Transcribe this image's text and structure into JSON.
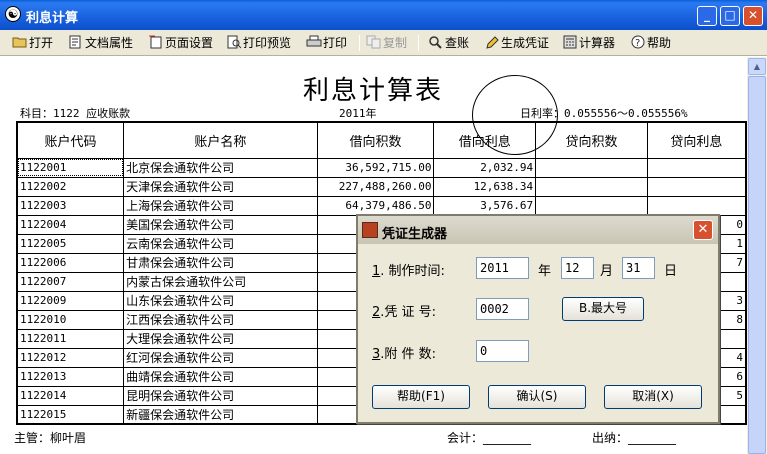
{
  "window": {
    "title": "利息计算",
    "minimize_label": "_",
    "maximize_label": "□",
    "close_label": "✕"
  },
  "toolbar": {
    "open": "打开",
    "doc_props": "文档属性",
    "page_setup": "页面设置",
    "print_preview": "打印预览",
    "print": "打印",
    "copy": "复制",
    "lookup": "查账",
    "gen_voucher": "生成凭证",
    "calculator": "计算器",
    "help": "帮助"
  },
  "report": {
    "title": "利息计算表",
    "subject": "科目：1122 应收账款",
    "year": "2011年",
    "daily_rate": "日利率：0.055556～0.055556%",
    "columns": [
      "账户代码",
      "账户名称",
      "借向积数",
      "借向利息",
      "贷向积数",
      "贷向利息"
    ],
    "rows": [
      {
        "code": "1122001",
        "name": "北京保会通软件公司",
        "debit_sum": "36,592,715.00",
        "debit_int": "2,032.94",
        "credit_sum": "",
        "credit_int": ""
      },
      {
        "code": "1122002",
        "name": "天津保会通软件公司",
        "debit_sum": "227,488,260.00",
        "debit_int": "12,638.34",
        "credit_sum": "",
        "credit_int": ""
      },
      {
        "code": "1122003",
        "name": "上海保会通软件公司",
        "debit_sum": "64,379,486.50",
        "debit_int": "3,576.67",
        "credit_sum": "",
        "credit_int": ""
      },
      {
        "code": "1122004",
        "name": "美国保会通软件公司",
        "debit_sum": "",
        "debit_int": "",
        "credit_sum": "",
        "credit_int": "0"
      },
      {
        "code": "1122005",
        "name": "云南保会通软件公司",
        "debit_sum": "1,29",
        "debit_int": "",
        "credit_sum": "",
        "credit_int": "1"
      },
      {
        "code": "1122006",
        "name": "甘肃保会通软件公司",
        "debit_sum": "",
        "debit_int": "",
        "credit_sum": "",
        "credit_int": "7"
      },
      {
        "code": "1122007",
        "name": "内蒙古保会通软件公司",
        "debit_sum": "4,26",
        "debit_int": "",
        "credit_sum": "",
        "credit_int": ""
      },
      {
        "code": "1122009",
        "name": "山东保会通软件公司",
        "debit_sum": "6",
        "debit_int": "",
        "credit_sum": "",
        "credit_int": "3"
      },
      {
        "code": "1122010",
        "name": "江西保会通软件公司",
        "debit_sum": "3",
        "debit_int": "",
        "credit_sum": "",
        "credit_int": "8"
      },
      {
        "code": "1122011",
        "name": "大理保会通软件公司",
        "debit_sum": "4,14",
        "debit_int": "",
        "credit_sum": "",
        "credit_int": ""
      },
      {
        "code": "1122012",
        "name": "红河保会通软件公司",
        "debit_sum": "7,74",
        "debit_int": "",
        "credit_sum": "",
        "credit_int": "4"
      },
      {
        "code": "1122013",
        "name": "曲靖保会通软件公司",
        "debit_sum": "10,30",
        "debit_int": "",
        "credit_sum": "",
        "credit_int": "6"
      },
      {
        "code": "1122014",
        "name": "昆明保会通软件公司",
        "debit_sum": "53",
        "debit_int": "",
        "credit_sum": "",
        "credit_int": "5"
      },
      {
        "code": "1122015",
        "name": "新疆保会通软件公司",
        "debit_sum": "63,45",
        "debit_int": "",
        "credit_sum": "",
        "credit_int": ""
      }
    ],
    "supervisor": "主管：柳叶眉",
    "accountant": "会计：________",
    "cashier": "出纳：________"
  },
  "dialog": {
    "title": "凭证生成器",
    "close_label": "✕",
    "label_time_num": "1",
    "label_time": ". 制作时间:",
    "year_value": "2011",
    "year_unit": "年",
    "month_value": "12",
    "month_unit": "月",
    "day_value": "31",
    "day_unit": "日",
    "label_voucher_num": "2",
    "label_voucher": ".凭 证 号:",
    "voucher_value": "0002",
    "max_button": "B.最大号",
    "label_attach_num": "3",
    "label_attach": ".附 件 数:",
    "attach_value": "0",
    "help_button": "帮助(F1)",
    "ok_button": "确认(S)",
    "cancel_button": "取消(X)"
  }
}
